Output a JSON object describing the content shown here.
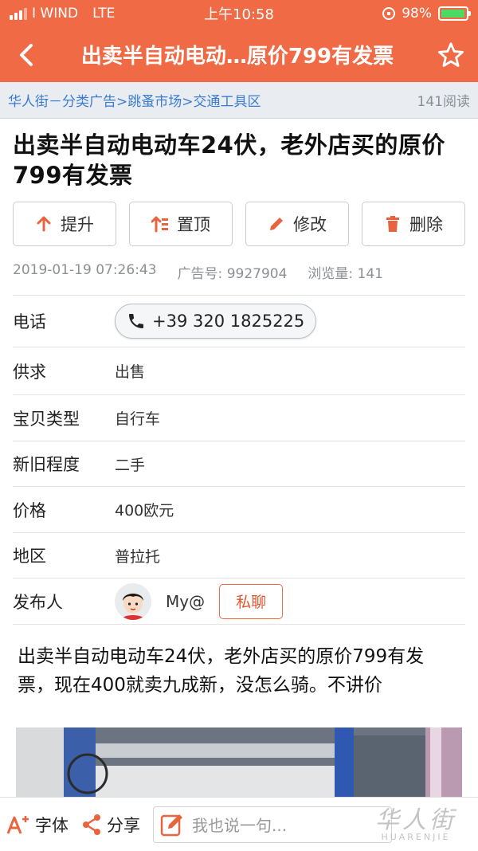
{
  "status_bar": {
    "carrier": "I WIND",
    "network": "LTE",
    "time": "上午10:58",
    "battery_percent": "98%",
    "battery_level": 0.98,
    "battery_color": "#4cd964"
  },
  "nav": {
    "back_icon": "chevron-left-icon",
    "title": "出卖半自动电动…原价799有发票",
    "favorite_icon": "star-outline-icon",
    "bar_color": "#ef6a45"
  },
  "breadcrumb": {
    "path": "华人街－分类广告>跳蚤市场>交通工具区",
    "views": "141阅读"
  },
  "post": {
    "title": "出卖半自动电动车24伏，老外店买的原价799有发票",
    "actions": [
      {
        "label": "提升",
        "icon": "arrow-up-icon"
      },
      {
        "label": "置顶",
        "icon": "pin-top-icon"
      },
      {
        "label": "修改",
        "icon": "pencil-icon"
      },
      {
        "label": "删除",
        "icon": "trash-icon"
      }
    ],
    "meta": {
      "date": "2019-01-19 07:26:43",
      "ad_no": "广告号: 9927904",
      "view_count": "浏览量: 141"
    },
    "fields": {
      "phone_label": "电话",
      "phone_value": "+39 320 1825225",
      "supply_label": "供求",
      "supply_value": "出售",
      "category_label": "宝贝类型",
      "category_value": "自行车",
      "condition_label": "新旧程度",
      "condition_value": "二手",
      "price_label": "价格",
      "price_value": "400欧元",
      "area_label": "地区",
      "area_value": "普拉托",
      "publisher_label": "发布人",
      "publisher_name": "My@",
      "chat_label": "私聊"
    },
    "description": "出卖半自动电动车24伏，老外店买的原价799有发票，现在400就卖九成新，没怎么骑。不讲价"
  },
  "bottom_bar": {
    "font_label": "字体",
    "share_label": "分享",
    "comment_placeholder": "我也说一句...",
    "watermark_main": "华人街",
    "watermark_sub": "HUARENJIE"
  }
}
